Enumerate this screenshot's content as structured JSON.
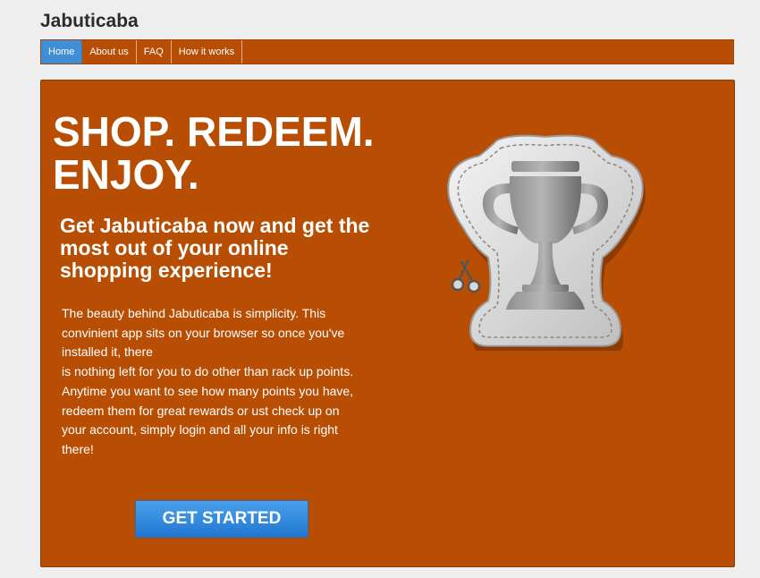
{
  "site": {
    "title": "Jabuticaba"
  },
  "nav": {
    "items": [
      {
        "label": "Home",
        "active": true
      },
      {
        "label": "About us",
        "active": false
      },
      {
        "label": "FAQ",
        "active": false
      },
      {
        "label": "How it works",
        "active": false
      }
    ]
  },
  "hero": {
    "headline": "SHOP. REDEEM. ENJOY.",
    "subheadline": "Get Jabuticaba now and get the most out of your online shopping experience!",
    "body_lines": [
      "The beauty behind Jabuticaba is simplicity. This convinient app sits on your browser so once you've installed it, there",
      "is nothing left for you to do other than rack up points. Anytime you want to see how many points you have,",
      "redeem them for great rewards or ust check up on your account, simply login and all your info is right there!"
    ],
    "cta_label": "GET STARTED",
    "badge_icon": "trophy-coupon-icon",
    "scissors_icon": "scissors-icon"
  },
  "colors": {
    "background": "#eeeeef",
    "brand_orange": "#b84e03",
    "nav_active": "#3f8fd6",
    "cta_blue": "#2277d1",
    "text_light": "#ffffff"
  }
}
